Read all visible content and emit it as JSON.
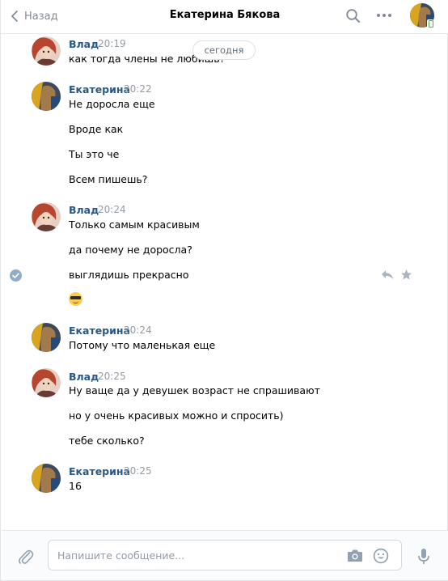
{
  "header": {
    "back_label": "Назад",
    "title": "Екатерина Бякова"
  },
  "date_pill": "сегодня",
  "messages": [
    {
      "author": "Влад",
      "time": "20:19",
      "lines": [
        "как тогда члены не любишь?"
      ]
    },
    {
      "author": "Екатерина",
      "time": "20:22",
      "lines": [
        "Не доросла еще",
        "Вроде как",
        "Ты это че",
        "Всем пишешь?"
      ]
    },
    {
      "author": "Влад",
      "time": "20:24",
      "lines": [
        "Только самым красивым",
        "да почему не доросла?",
        "выглядишь прекрасно"
      ],
      "emoji": "sunglasses-emoji"
    },
    {
      "author": "Екатерина",
      "time": "20:24",
      "lines": [
        "Потому что маленькая еще"
      ]
    },
    {
      "author": "Влад",
      "time": "20:25",
      "lines": [
        "Ну ваще да у девушек возраст не спрашивают",
        "но у очень красивых можно и спросить)",
        "тебе сколько?"
      ]
    },
    {
      "author": "Екатерина",
      "time": "20:25",
      "lines": [
        "16"
      ]
    }
  ],
  "composer": {
    "placeholder": "Напишите сообщение..."
  },
  "colors": {
    "link": "#2a5885",
    "muted": "#939ba5",
    "icon": "#828a99",
    "check": "#8fadc8"
  },
  "icons": [
    "chevron-left-icon",
    "search-icon",
    "more-icon",
    "reply-icon",
    "star-icon",
    "check-circle-icon",
    "paperclip-icon",
    "camera-icon",
    "smile-icon",
    "microphone-icon"
  ]
}
